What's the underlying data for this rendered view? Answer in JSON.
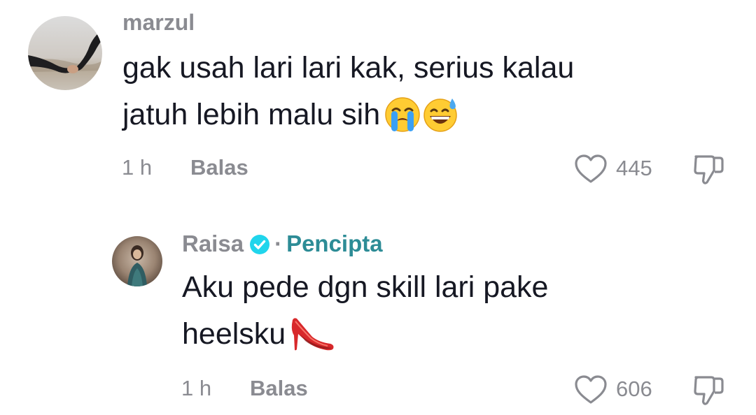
{
  "comments": [
    {
      "username": "marzul",
      "text_line1": "gak usah lari lari kak, serius kalau",
      "text_line2": "jatuh lebih malu sih",
      "emojis": [
        "loudly-crying-face-icon",
        "grinning-sweat-face-icon"
      ],
      "time": "1 h",
      "reply_label": "Balas",
      "likes": "445"
    },
    {
      "username": "Raisa",
      "verified": true,
      "separator": "·",
      "creator_tag": "Pencipta",
      "text_line1": "Aku pede dgn skill lari pake",
      "text_line2": "heelsku",
      "emojis": [
        "high-heel-shoe-icon"
      ],
      "time": "1 h",
      "reply_label": "Balas",
      "likes": "606"
    }
  ],
  "colors": {
    "text_primary": "#161823",
    "text_secondary": "#8a8b91",
    "creator_accent": "#2d8c96",
    "verified_badge": "#20d5ec"
  }
}
